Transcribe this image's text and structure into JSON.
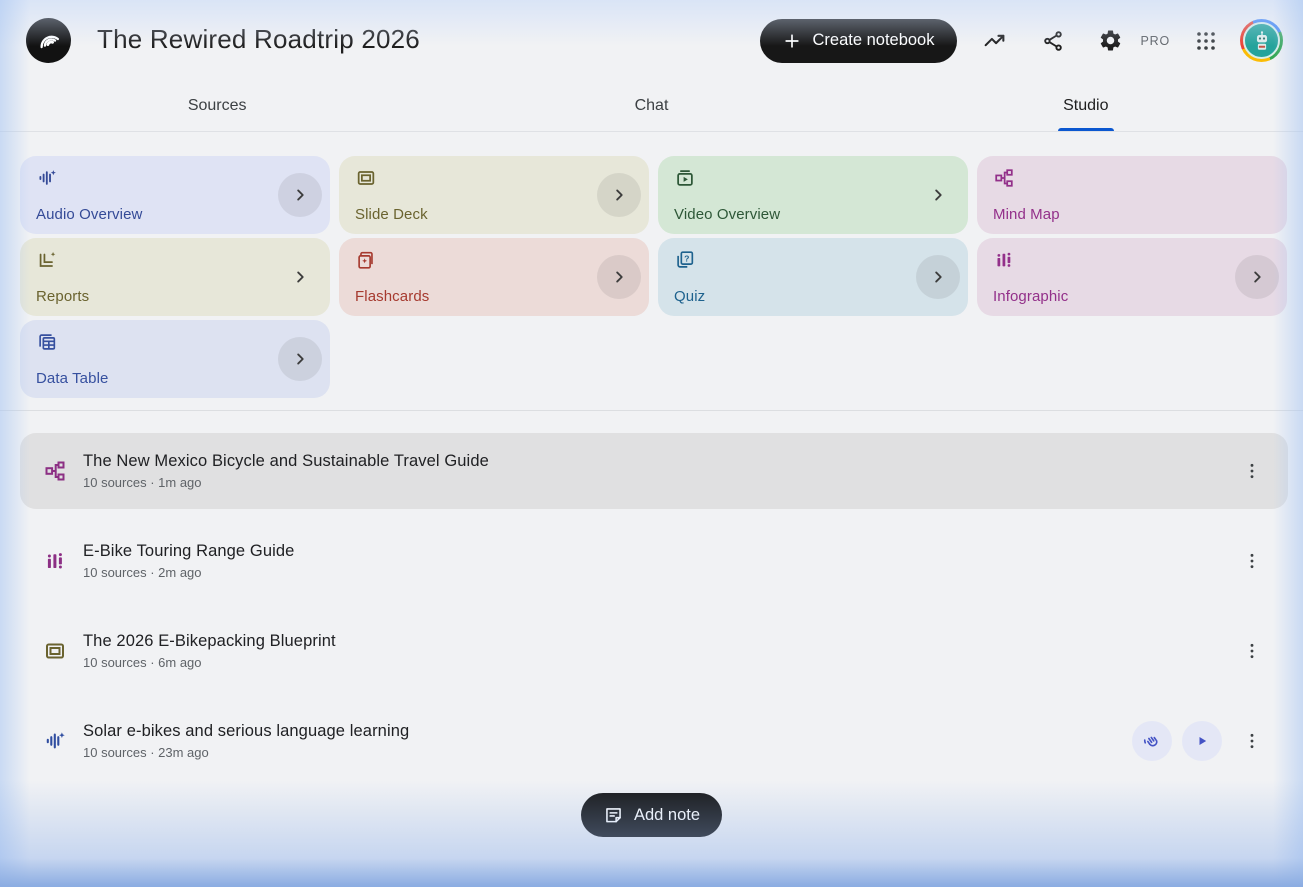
{
  "header": {
    "title": "The Rewired Roadtrip 2026",
    "create_button": "Create notebook",
    "pro_label": "PRO",
    "icons": [
      "notebooklm-logo",
      "plus-icon",
      "trending-up-icon",
      "share-icon",
      "settings-gear-icon",
      "apps-grid-icon",
      "avatar"
    ]
  },
  "tabs": [
    {
      "label": "Sources",
      "active": false
    },
    {
      "label": "Chat",
      "active": false
    },
    {
      "label": "Studio",
      "active": true
    }
  ],
  "colors": {
    "tab_underline": "#0b57d0",
    "dark_button": "#171717",
    "selected_row": "#e0e0e1",
    "action_button_bg": "#e4e7f6",
    "action_icon": "#4453c5",
    "meta_text": "#5f6368"
  },
  "studio_cards": [
    {
      "label": "Audio Overview",
      "icon": "audio-waveform-sparkle-icon",
      "bg": "#dfe3f4",
      "fg": "#344a97",
      "chevron": "circle"
    },
    {
      "label": "Slide Deck",
      "icon": "slide-deck-icon",
      "bg": "#e7e7d9",
      "fg": "#6a632f",
      "chevron": "circle"
    },
    {
      "label": "Video Overview",
      "icon": "video-overview-icon",
      "bg": "#d4e7d5",
      "fg": "#2d5737",
      "chevron": "plain"
    },
    {
      "label": "Mind Map",
      "icon": "mind-map-icon",
      "bg": "#e7dae5",
      "fg": "#93308a",
      "chevron": "none"
    },
    {
      "label": "Reports",
      "icon": "reports-sparkle-icon",
      "bg": "#e7e7d9",
      "fg": "#6a632f",
      "chevron": "plain"
    },
    {
      "label": "Flashcards",
      "icon": "flashcards-icon",
      "bg": "#ecdbd8",
      "fg": "#a63a2f",
      "chevron": "circle"
    },
    {
      "label": "Quiz",
      "icon": "quiz-icon",
      "bg": "#d5e3ea",
      "fg": "#1e628e",
      "chevron": "circle"
    },
    {
      "label": "Infographic",
      "icon": "infographic-icon",
      "bg": "#e7dae5",
      "fg": "#93308a",
      "chevron": "circle"
    },
    {
      "label": "Data Table",
      "icon": "data-table-icon",
      "bg": "#dde2f1",
      "fg": "#36509f",
      "chevron": "circle"
    }
  ],
  "artifacts": [
    {
      "icon": "mind-map-icon",
      "title": "The New Mexico Bicycle and Sustainable Travel Guide",
      "meta": "10 sources · 1m ago",
      "selected": true
    },
    {
      "icon": "infographic-icon",
      "title": "E-Bike Touring Range Guide",
      "meta": "10 sources · 2m ago",
      "selected": false
    },
    {
      "icon": "slide-deck-icon",
      "title": "The 2026 E-Bikepacking Blueprint",
      "meta": "10 sources · 6m ago",
      "selected": false
    },
    {
      "icon": "audio-waveform-sparkle-icon",
      "title": "Solar e-bikes and serious language learning",
      "meta": "10 sources · 23m ago",
      "selected": false,
      "actions": [
        "interactive-mode-hand-icon",
        "play-icon",
        "more-options-icon"
      ]
    }
  ],
  "footer": {
    "add_note_label": "Add note",
    "icon": "note-icon"
  }
}
